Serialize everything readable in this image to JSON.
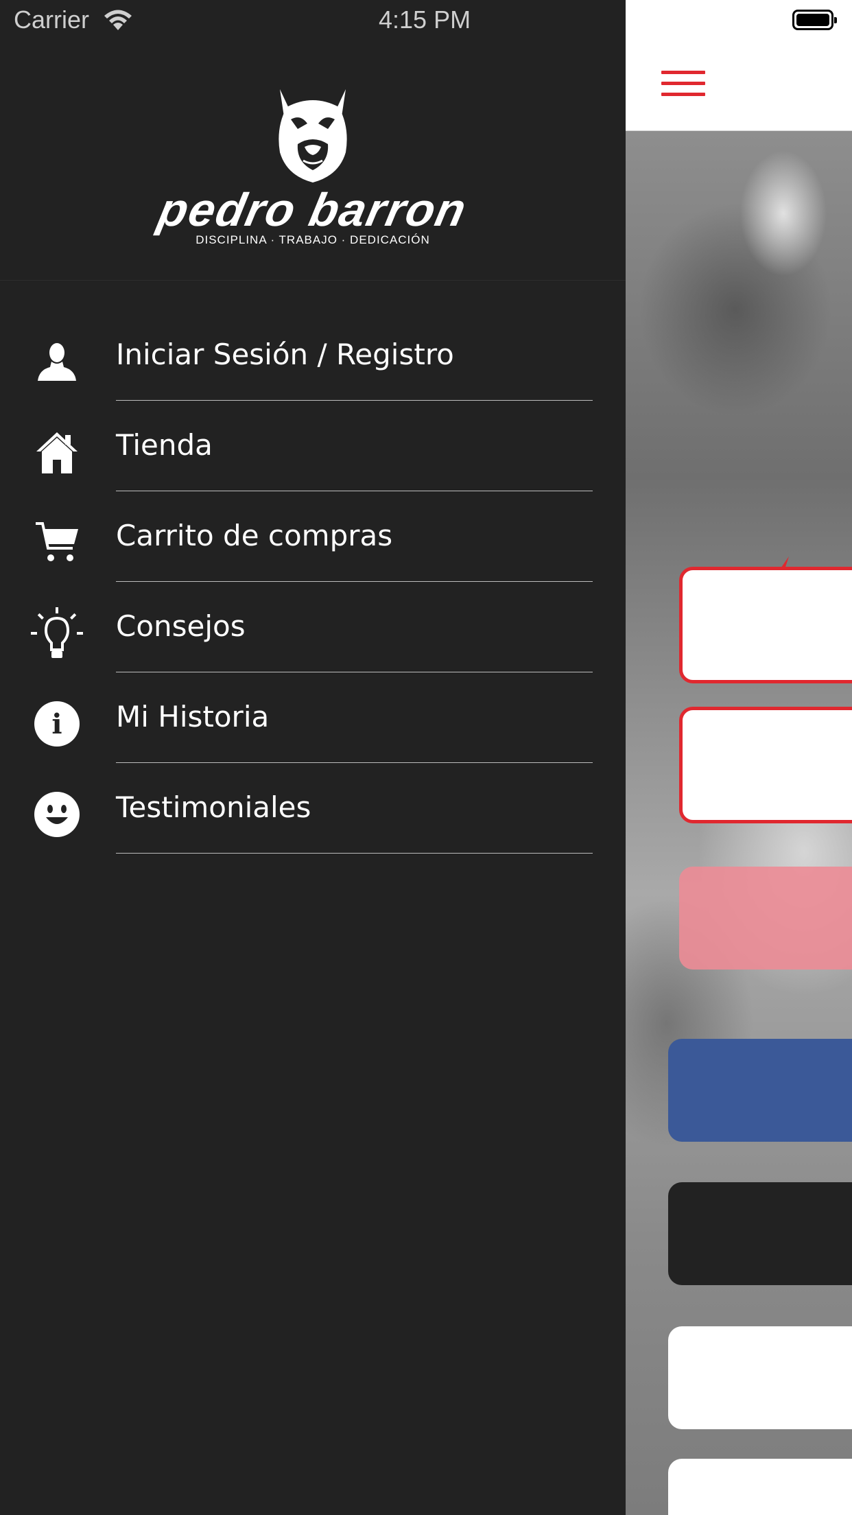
{
  "status_bar": {
    "carrier": "Carrier",
    "time": "4:15 PM"
  },
  "brand": {
    "name": "pedro barron",
    "tagline": "DISCIPLINA · TRABAJO · DEDICACIÓN"
  },
  "menu": {
    "items": [
      {
        "label": "Iniciar Sesión / Registro",
        "icon": "user-icon"
      },
      {
        "label": "Tienda",
        "icon": "home-icon"
      },
      {
        "label": "Carrito de compras",
        "icon": "cart-icon"
      },
      {
        "label": "Consejos",
        "icon": "lightbulb-icon"
      },
      {
        "label": "Mi Historia",
        "icon": "info-icon"
      },
      {
        "label": "Testimoniales",
        "icon": "smiley-icon"
      }
    ]
  },
  "colors": {
    "drawer_bg": "#222222",
    "accent_red": "#e0282f",
    "facebook_blue": "#3b5998"
  }
}
